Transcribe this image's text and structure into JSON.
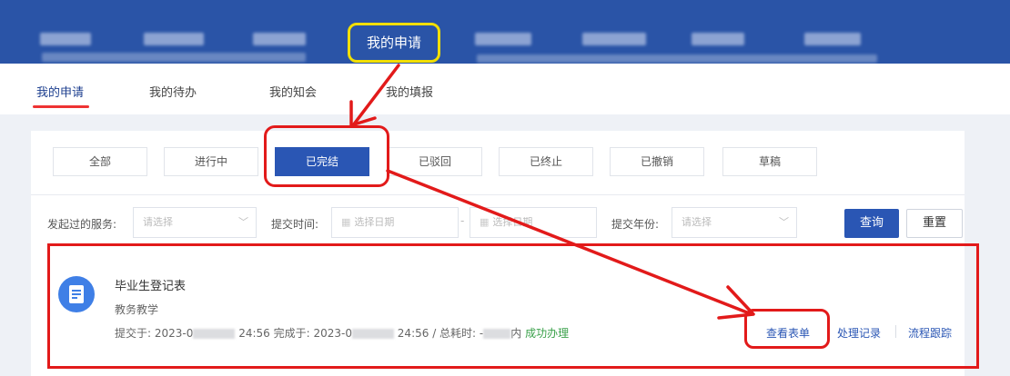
{
  "topnav": {
    "active_item": "我的申请",
    "highlight_color": "#f2df00",
    "background_color": "#2a54a7"
  },
  "tabs": [
    "我的申请",
    "我的待办",
    "我的知会",
    "我的填报"
  ],
  "status_filters": {
    "items": [
      "全部",
      "进行中",
      "已完结",
      "已驳回",
      "已终止",
      "已撤销",
      "草稿"
    ],
    "selected": "已完结"
  },
  "filters": {
    "service_label": "发起过的服务:",
    "service_placeholder": "请选择",
    "time_label": "提交时间:",
    "date_start_placeholder": "选择日期",
    "date_end_placeholder": "选择日期",
    "year_label": "提交年份:",
    "year_placeholder": "请选择",
    "query_label": "查询",
    "reset_label": "重置"
  },
  "record": {
    "title": "毕业生登记表",
    "category": "教务教学",
    "submitted_prefix": "提交于: 2023-0",
    "submitted_suffix": "24:56 完成于: 2023-0",
    "completed_suffix": "24:56 / 总耗时: -",
    "duration_suffix": "内",
    "status": "成功办理",
    "actions": [
      "查看表单",
      "处理记录",
      "流程跟踪"
    ]
  },
  "annotation_color": "#e21a1a"
}
